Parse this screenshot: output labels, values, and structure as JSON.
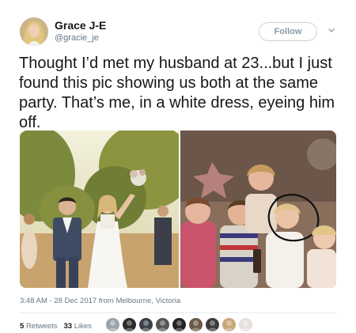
{
  "user": {
    "name": "Grace J-E",
    "handle": "@gracie_je"
  },
  "follow_label": "Follow",
  "tweet_text": "Thought I’d met my husband at 23...but I just found this pic showing us both at the same party. That’s me, in a white dress, eyeing him off.",
  "meta": {
    "time": "3:48 AM - 28 Dec 2017",
    "from_label": "from",
    "location": "Melbourne, Victoria"
  },
  "stats": {
    "retweets_count": "5",
    "retweets_label": "Retweets",
    "likes_count": "33",
    "likes_label": "Likes"
  },
  "likers": [
    {
      "icon": "liker-avatar",
      "color": "#9aa3ad"
    },
    {
      "icon": "liker-avatar",
      "color": "#2b2b2b"
    },
    {
      "icon": "liker-avatar",
      "color": "#3a3f4a"
    },
    {
      "icon": "liker-avatar",
      "color": "#555555"
    },
    {
      "icon": "liker-avatar",
      "color": "#222222"
    },
    {
      "icon": "liker-avatar",
      "color": "#6b5a4a"
    },
    {
      "icon": "liker-avatar",
      "color": "#3b3b3b"
    },
    {
      "icon": "liker-avatar",
      "color": "#c9a77a"
    },
    {
      "icon": "liker-avatar",
      "color": "#e8e0dc"
    }
  ],
  "colors": {
    "text": "#14171a",
    "muted": "#657786",
    "border": "#e6ecf0",
    "follow_border": "#c9d2da"
  }
}
